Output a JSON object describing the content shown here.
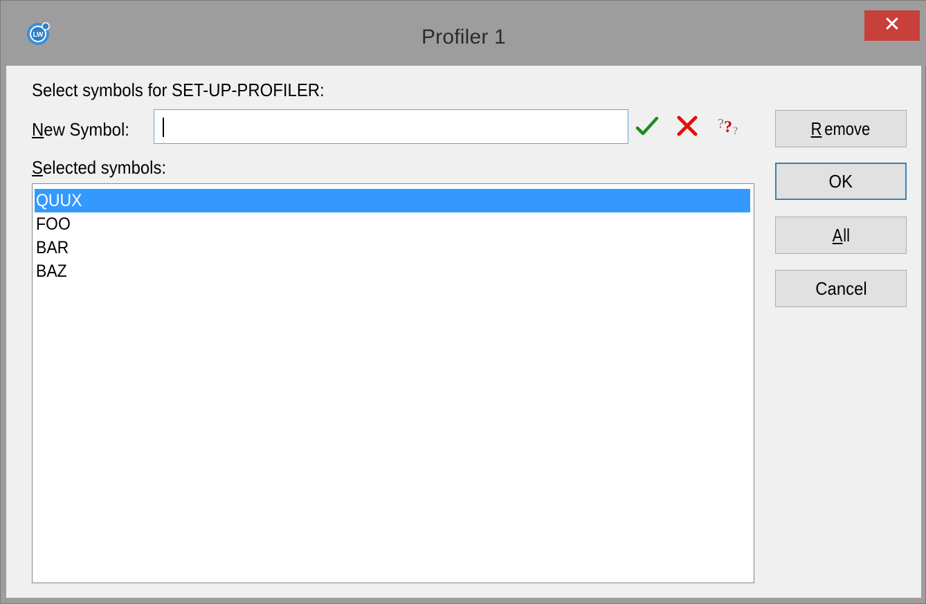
{
  "window": {
    "title": "Profiler 1",
    "icon": "lispworks-app-icon",
    "close_glyph": "✕"
  },
  "form": {
    "prompt": "Select symbols for SET-UP-PROFILER:",
    "new_symbol_label_mnemonic": "N",
    "new_symbol_label_rest": "ew Symbol:",
    "new_symbol_value": "",
    "selected_label_mnemonic": "S",
    "selected_label_rest": "elected symbols:"
  },
  "tools": {
    "confirm_icon": "green-check-icon",
    "clear_icon": "red-cross-icon",
    "complete_icon": "question-marks-icon"
  },
  "symbols": {
    "items": [
      "QUUX",
      "FOO",
      "BAR",
      "BAZ"
    ],
    "selected_index": 0
  },
  "buttons": {
    "remove_mnemonic": "R",
    "remove_rest": "emove",
    "ok": "OK",
    "all_mnemonic": "A",
    "all_rest": "ll",
    "cancel": "Cancel"
  },
  "colors": {
    "selection": "#3399ff",
    "close_button": "#c7403a",
    "check": "#1e8a1e",
    "cross": "#e01010"
  }
}
